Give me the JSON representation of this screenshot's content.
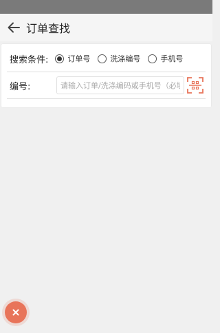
{
  "header": {
    "title": "订单查找",
    "back_icon": "arrow-left-icon"
  },
  "search": {
    "condition_label": "搜索条件:",
    "options": [
      {
        "label": "订单号",
        "selected": true
      },
      {
        "label": "洗涤编号",
        "selected": false
      },
      {
        "label": "手机号",
        "selected": false
      }
    ],
    "number_label": "编号:",
    "number_value": "",
    "number_placeholder": "请输入订单/洗涤编码或手机号（必填",
    "scan_icon": "qr-scan-icon"
  },
  "fab": {
    "icon": "close-icon"
  },
  "colors": {
    "accent": "#e8745a",
    "background": "#f0f0f0",
    "status_bar": "#7a7a7a"
  }
}
